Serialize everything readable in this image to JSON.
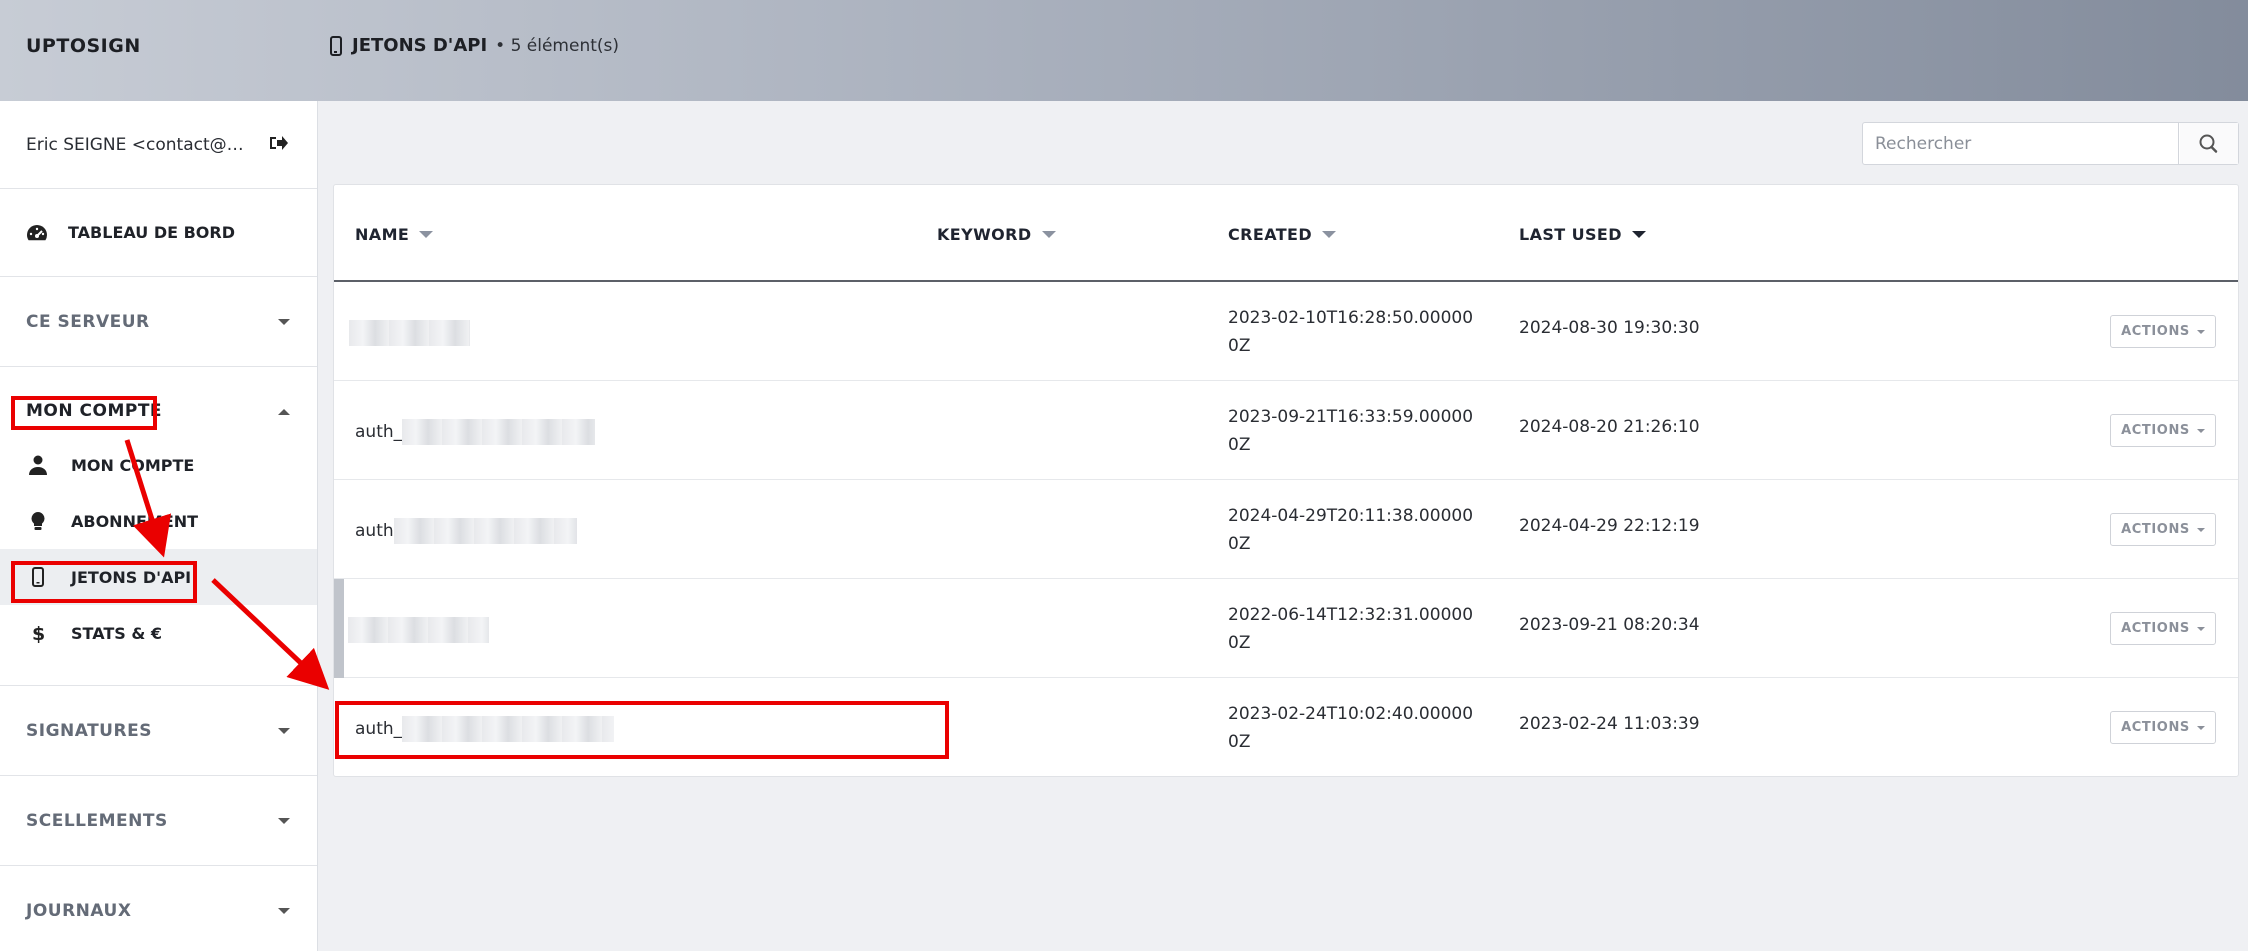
{
  "app": {
    "brand": "UPTOSIGN"
  },
  "header": {
    "title": "JETONS D'API",
    "count": "• 5 élément(s)",
    "icon": "mobile-icon"
  },
  "sidebar": {
    "user": "Eric SEIGNE <contact@cap...",
    "nav": [
      {
        "label": "TABLEAU DE BORD",
        "icon": "dashboard-icon"
      },
      {
        "label": "CE SERVEUR",
        "icon": "chevron-down-icon"
      },
      {
        "label": "MON COMPTE",
        "icon": "chevron-up-icon"
      }
    ],
    "account_items": [
      {
        "label": "MON COMPTE",
        "icon": "user-icon"
      },
      {
        "label": "ABONNEMENT",
        "icon": "lightbulb-icon"
      },
      {
        "label": "JETONS D'API",
        "icon": "mobile-icon"
      },
      {
        "label": "STATS & €",
        "icon": "dollar-icon"
      }
    ],
    "sections": [
      {
        "label": "SIGNATURES"
      },
      {
        "label": "SCELLEMENTS"
      },
      {
        "label": "JOURNAUX"
      }
    ]
  },
  "search": {
    "placeholder": "Rechercher"
  },
  "table": {
    "columns": [
      "NAME",
      "KEYWORD",
      "CREATED",
      "LAST USED"
    ],
    "rows": [
      {
        "name": "",
        "keyword": "",
        "created": "2023-02-10T16:28:50.000000Z",
        "last_used": "2024-08-30 19:30:30",
        "action": "ACTIONS"
      },
      {
        "name": "auth_",
        "keyword": "",
        "created": "2023-09-21T16:33:59.000000Z",
        "last_used": "2024-08-20 21:26:10",
        "action": "ACTIONS"
      },
      {
        "name": "auth",
        "keyword": "",
        "created": "2024-04-29T20:11:38.000000Z",
        "last_used": "2024-04-29 22:12:19",
        "action": "ACTIONS"
      },
      {
        "name": "",
        "keyword": "",
        "created": "2022-06-14T12:32:31.000000Z",
        "last_used": "2023-09-21 08:20:34",
        "action": "ACTIONS"
      },
      {
        "name": "auth_",
        "keyword": "",
        "created": "2023-02-24T10:02:40.000000Z",
        "last_used": "2023-02-24 11:03:39",
        "action": "ACTIONS"
      }
    ]
  },
  "colors": {
    "annotation": "#ea0000",
    "header_start": "#c7ccd5",
    "header_end": "#838c9c"
  }
}
